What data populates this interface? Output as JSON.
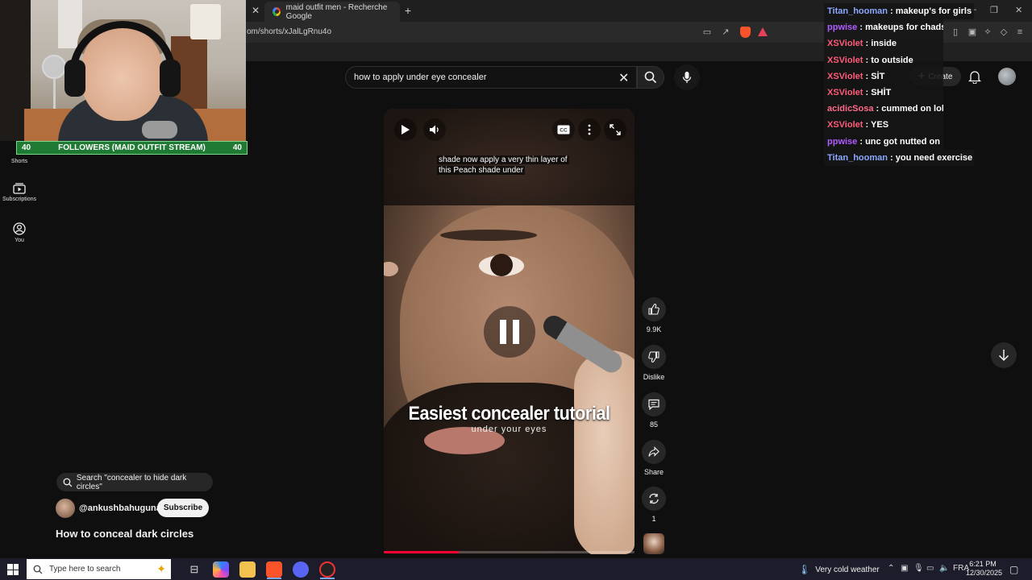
{
  "browser": {
    "tab_title": "maid outfit men - Recherche Google",
    "url": "om/shorts/xJalLgRnu4o"
  },
  "header": {
    "search_query": "how to apply under eye concealer",
    "create_label": "Create"
  },
  "nav": {
    "items": [
      {
        "label": "Shorts",
        "icon": "shorts-icon"
      },
      {
        "label": "Subscriptions",
        "icon": "subscriptions-icon"
      },
      {
        "label": "You",
        "icon": "user-icon"
      }
    ]
  },
  "stream_overlay": {
    "followers_left": "40",
    "followers_label": "FOLLOWERS (MAID OUTFIT STREAM)",
    "followers_right": "40"
  },
  "video": {
    "caption": "shade now apply a very thin layer of this Peach shade under",
    "overlay_title": "Easiest concealer tutorial",
    "overlay_subtitle": "under your eyes",
    "progress": 0.3
  },
  "actions": {
    "like_count": "9.9K",
    "dislike_label": "Dislike",
    "comment_count": "85",
    "share_label": "Share",
    "remix_count": "1"
  },
  "meta": {
    "suggested_search": "Search \"concealer to hide dark circles\"",
    "channel": "@ankushbahuguna",
    "subscribe_label": "Subscribe",
    "title": "How to conceal dark circles"
  },
  "chat": [
    {
      "user": "Titan_hooman",
      "color": "#8aa8ff",
      "message": "makeup's for girls"
    },
    {
      "user": "ppwise",
      "color": "#b05cff",
      "message": "makeups for chads"
    },
    {
      "user": "XSViolet",
      "color": "#ff5c7a",
      "message": "inside"
    },
    {
      "user": "XSViolet",
      "color": "#ff5c7a",
      "message": "to outside"
    },
    {
      "user": "XSViolet",
      "color": "#ff5c7a",
      "message": "SİT"
    },
    {
      "user": "XSViolet",
      "color": "#ff5c7a",
      "message": "SHİT"
    },
    {
      "user": "acidicSosa",
      "color": "#ff6a88",
      "message": "cummed on lol"
    },
    {
      "user": "XSViolet",
      "color": "#ff5c7a",
      "message": "YES"
    },
    {
      "user": "ppwise",
      "color": "#b05cff",
      "message": "unc got nutted on"
    },
    {
      "user": "Titan_hooman",
      "color": "#8aa8ff",
      "message": "you need exercise"
    }
  ],
  "taskbar": {
    "search_placeholder": "Type here to search",
    "weather": "Very cold weather",
    "language": "FRA",
    "time": "6:21 PM",
    "date": "12/30/2025"
  }
}
